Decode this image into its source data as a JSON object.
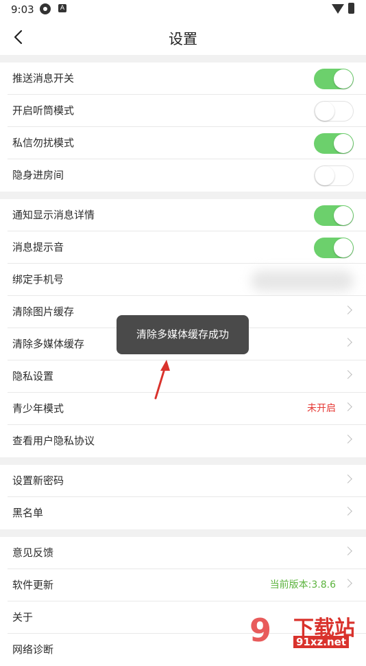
{
  "status_bar": {
    "time": "9:03",
    "icons": [
      "network-icon",
      "a-badge-icon",
      "wifi-icon",
      "battery-icon"
    ]
  },
  "header": {
    "title": "设置",
    "back_icon": "chevron-left-icon"
  },
  "groups": [
    [
      {
        "label": "推送消息开关",
        "control": "toggle",
        "on": true
      },
      {
        "label": "开启听筒模式",
        "control": "toggle",
        "on": false
      },
      {
        "label": "私信勿扰模式",
        "control": "toggle",
        "on": true
      },
      {
        "label": "隐身进房间",
        "control": "toggle",
        "on": false
      }
    ],
    [
      {
        "label": "通知显示消息详情",
        "control": "toggle",
        "on": true
      },
      {
        "label": "消息提示音",
        "control": "toggle",
        "on": true
      },
      {
        "label": "绑定手机号",
        "control": "blurred"
      },
      {
        "label": "清除图片缓存",
        "control": "chevron"
      },
      {
        "label": "清除多媒体缓存",
        "control": "chevron"
      },
      {
        "label": "隐私设置",
        "control": "chevron"
      },
      {
        "label": "青少年模式",
        "control": "chevron",
        "value": "未开启",
        "value_color": "#e53935"
      },
      {
        "label": "查看用户隐私协议",
        "control": "chevron"
      }
    ],
    [
      {
        "label": "设置新密码",
        "control": "chevron"
      },
      {
        "label": "黑名单",
        "control": "chevron"
      }
    ],
    [
      {
        "label": "意见反馈",
        "control": "chevron"
      },
      {
        "label": "软件更新",
        "control": "chevron",
        "value": "当前版本:3.8.6",
        "value_color": "#5bb33d"
      },
      {
        "label": "关于",
        "control": "none"
      },
      {
        "label": "网络诊断",
        "control": "none"
      }
    ]
  ],
  "toast": {
    "text": "清除多媒体缓存成功"
  },
  "watermark": {
    "main": "下载站",
    "sub": "91xz.net",
    "digit": "9"
  },
  "colors": {
    "toggle_on": "#6cd06c",
    "accent_red": "#e53935",
    "accent_green": "#5bb33d",
    "toast_bg": "#4a4a4a"
  }
}
